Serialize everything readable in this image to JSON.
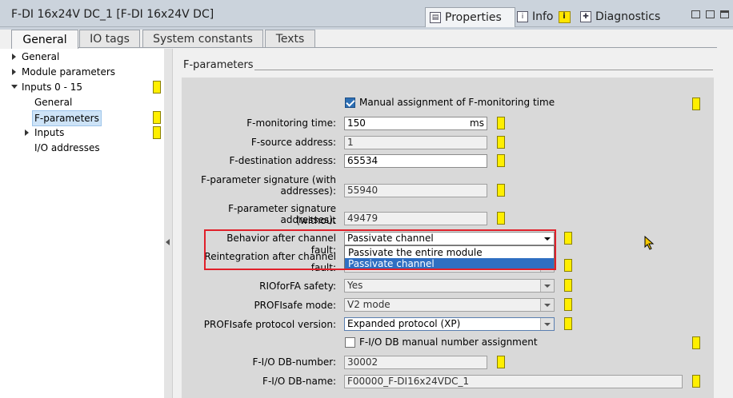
{
  "window": {
    "title": "F-DI 16x24V DC_1 [F-DI 16x24V DC]"
  },
  "panel_tabs": [
    {
      "label": "Properties",
      "icon": "properties-icon"
    },
    {
      "label": "Info",
      "icon": "info-icon",
      "badge": "i"
    },
    {
      "label": "Diagnostics",
      "icon": "diagnostics-icon"
    }
  ],
  "sub_tabs": [
    "General",
    "IO tags",
    "System constants",
    "Texts"
  ],
  "nav": {
    "items": [
      {
        "label": "General"
      },
      {
        "label": "Module parameters"
      },
      {
        "label": "Inputs 0 - 15"
      },
      {
        "label": "General"
      },
      {
        "label": "F-parameters"
      },
      {
        "label": "Inputs"
      },
      {
        "label": "I/O addresses"
      }
    ]
  },
  "section": {
    "title": "F-parameters"
  },
  "form": {
    "manual_monitoring_label": "Manual assignment of F-monitoring time",
    "manual_monitoring_checked": true,
    "monitoring_time_label": "F-monitoring time:",
    "monitoring_time_value": "150",
    "monitoring_time_unit": "ms",
    "source_address_label": "F-source address:",
    "source_address_value": "1",
    "destination_address_label": "F-destination address:",
    "destination_address_value": "65534",
    "sig_with_label_1": "F-parameter signature (with",
    "sig_with_label_2": "addresses):",
    "sig_with_value": "55940",
    "sig_without_label_1": "F-parameter signature (without",
    "sig_without_label_2": "addresses):",
    "sig_without_value": "49479",
    "behavior_label": "Behavior after channel fault:",
    "behavior_value": "Passivate channel",
    "behavior_options": [
      "Passivate the entire module",
      "Passivate channel"
    ],
    "reintegration_label_1": "Reintegration after channel",
    "reintegration_label_2": "fault:",
    "riofa_label": "RIOforFA safety:",
    "riofa_value": "Yes",
    "profisafe_mode_label": "PROFIsafe mode:",
    "profisafe_mode_value": "V2 mode",
    "protocol_label": "PROFIsafe protocol version:",
    "protocol_value": "Expanded protocol (XP)",
    "db_manual_label": "F-I/O DB manual number assignment",
    "db_manual_checked": false,
    "db_number_label": "F-I/O DB-number:",
    "db_number_value": "30002",
    "db_name_label": "F-I/O DB-name:",
    "db_name_value": "F00000_F-DI16x24VDC_1"
  },
  "colors": {
    "flag": "#ffef00",
    "highlight": "#e0202a",
    "selection": "#2f6fc2"
  }
}
